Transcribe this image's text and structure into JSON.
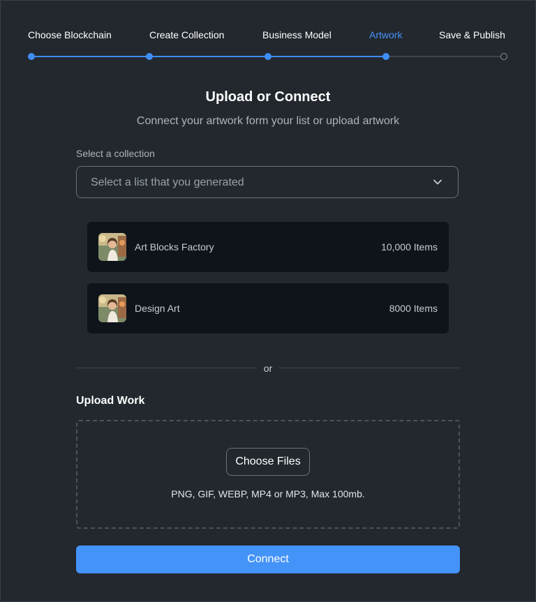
{
  "stepper": {
    "steps": [
      {
        "label": "Choose Blockchain",
        "state": "done"
      },
      {
        "label": "Create Collection",
        "state": "done"
      },
      {
        "label": "Business Model",
        "state": "done"
      },
      {
        "label": "Artwork",
        "state": "active"
      },
      {
        "label": "Save & Publish",
        "state": "pending"
      }
    ]
  },
  "header": {
    "title": "Upload or Connect",
    "subtitle": "Connect your artwork form your list or upload artwork"
  },
  "collection": {
    "label": "Select a collection",
    "placeholder": "Select a list that you generated",
    "items": [
      {
        "name": "Art Blocks Factory",
        "count": "10,000 Items",
        "thumb_icon": "avatar-image"
      },
      {
        "name": "Design Art",
        "count": "8000 Items",
        "thumb_icon": "avatar-image"
      }
    ]
  },
  "divider": {
    "label": "or"
  },
  "upload": {
    "title": "Upload Work",
    "button_label": "Choose Files",
    "formats_text": "PNG, GIF, WEBP, MP4 or MP3, Max 100mb."
  },
  "actions": {
    "connect_label": "Connect"
  },
  "colors": {
    "background": "#23282f",
    "accent": "#4493f8",
    "card": "#0f141b",
    "muted_text": "#aeb4bd"
  }
}
